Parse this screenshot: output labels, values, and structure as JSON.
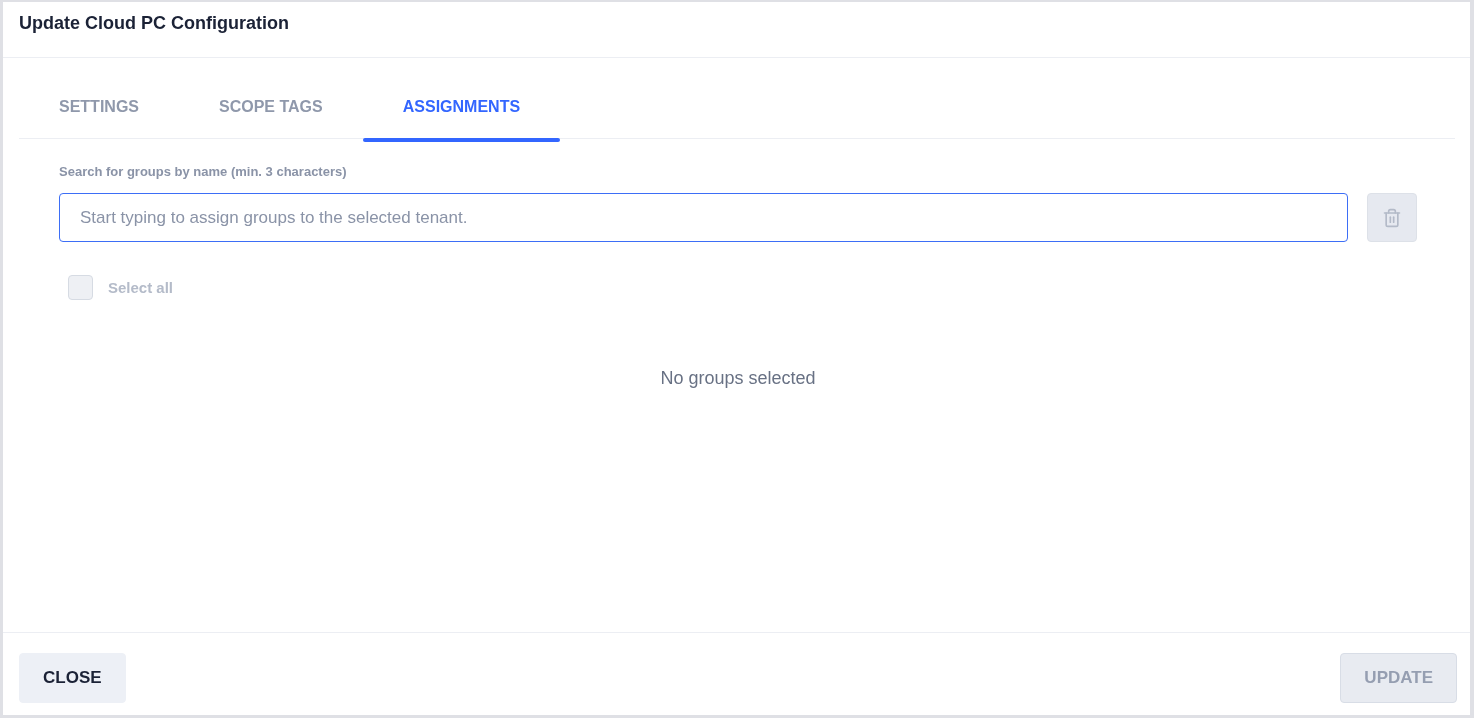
{
  "dialog": {
    "title": "Update Cloud PC Configuration"
  },
  "tabs": [
    {
      "label": "SETTINGS",
      "selected": false
    },
    {
      "label": "SCOPE TAGS",
      "selected": false
    },
    {
      "label": "ASSIGNMENTS",
      "selected": true
    }
  ],
  "search": {
    "label": "Search for groups by name (min. 3 characters)",
    "placeholder": "Start typing to assign groups to the selected tenant.",
    "delete_disabled": true
  },
  "select_all": {
    "label": "Select all",
    "checked": false,
    "disabled": true
  },
  "empty_message": "No groups selected",
  "footer": {
    "buttons": [
      {
        "label": "CLOSE",
        "kind": "secondary",
        "disabled": false
      },
      {
        "label": "UPDATE",
        "kind": "primary",
        "disabled": true
      }
    ]
  }
}
